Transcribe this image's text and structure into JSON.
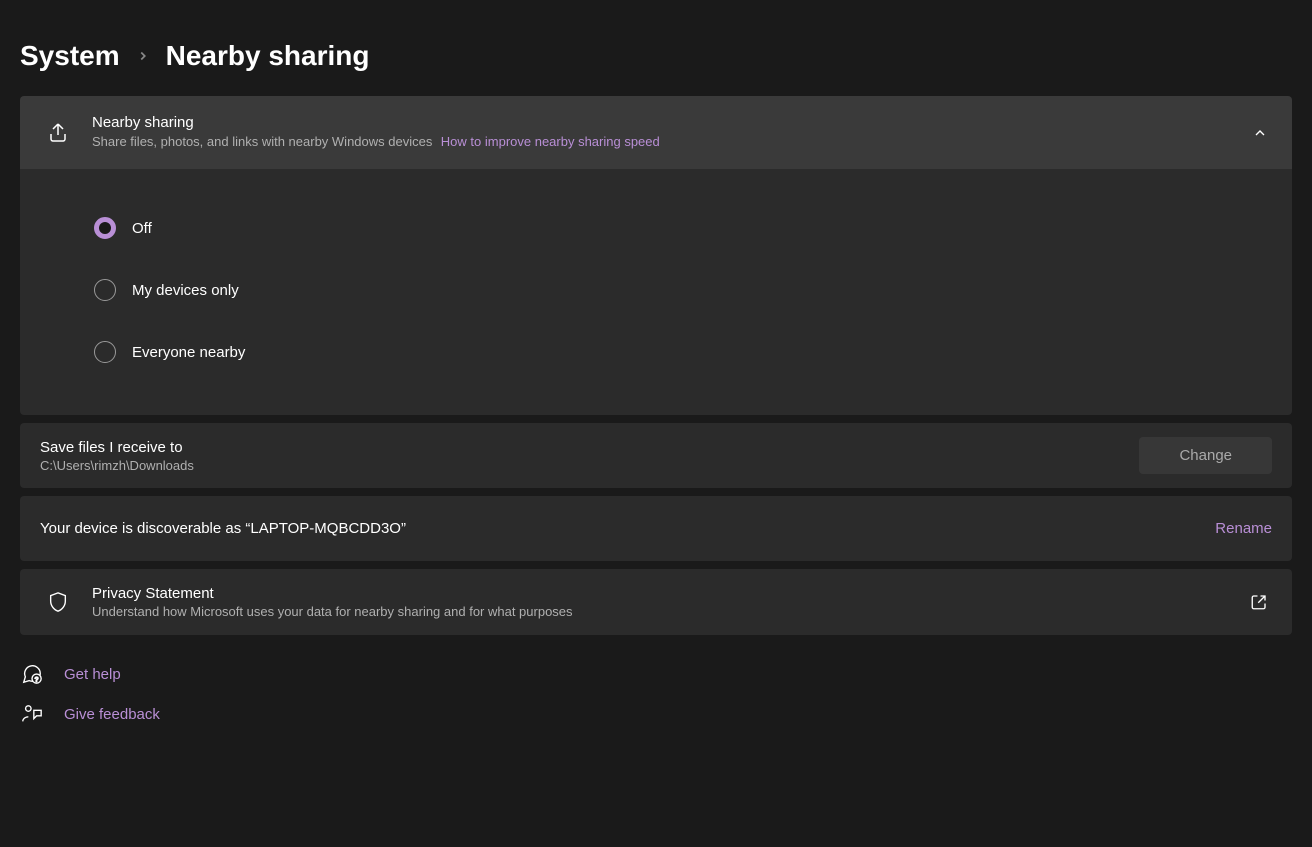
{
  "breadcrumb": {
    "parent": "System",
    "current": "Nearby sharing"
  },
  "nearby_card": {
    "title": "Nearby sharing",
    "subtitle": "Share files, photos, and links with nearby Windows devices",
    "link": "How to improve nearby sharing speed"
  },
  "radio": {
    "options": [
      {
        "label": "Off"
      },
      {
        "label": "My devices only"
      },
      {
        "label": "Everyone nearby"
      }
    ],
    "selected": 0
  },
  "save_files": {
    "title": "Save files I receive to",
    "path": "C:\\Users\\rimzh\\Downloads",
    "button": "Change"
  },
  "device": {
    "text": "Your device is discoverable as “LAPTOP-MQBCDD3O”",
    "action": "Rename"
  },
  "privacy": {
    "title": "Privacy Statement",
    "subtitle": "Understand how Microsoft uses your data for nearby sharing and for what purposes"
  },
  "bottom_links": {
    "get_help": "Get help",
    "give_feedback": "Give feedback"
  }
}
